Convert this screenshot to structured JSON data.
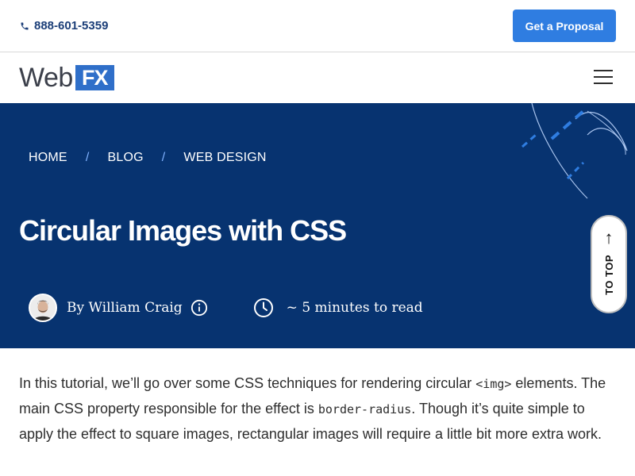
{
  "topbar": {
    "phone": "888-601-5359",
    "cta": "Get a Proposal"
  },
  "nav": {
    "logo_web": "Web",
    "logo_fx": "FX",
    "menu_icon": "hamburger-icon"
  },
  "hero": {
    "breadcrumb": [
      "HOME",
      "BLOG",
      "WEB DESIGN"
    ],
    "separator": "/",
    "title": "Circular Images with CSS",
    "author": "By William Craig",
    "read_time": "~ 5 minutes to read",
    "to_top_label": "TO TOP",
    "to_top_arrow": "↑"
  },
  "article": {
    "p1_a": "In this tutorial, we’ll go over some CSS techniques for rendering circular ",
    "p1_code1": "<img>",
    "p1_b": " elements. The main CSS property responsible for the effect is ",
    "p1_code2": "border-radius",
    "p1_c": ". Though it’s quite simple to apply the effect to square images, rectangular images will require a little bit more extra work."
  },
  "colors": {
    "hero_bg": "#073370",
    "accent": "#2f7de1",
    "brand_fx": "#2f6fc9",
    "phone_text": "#1b3e78"
  }
}
